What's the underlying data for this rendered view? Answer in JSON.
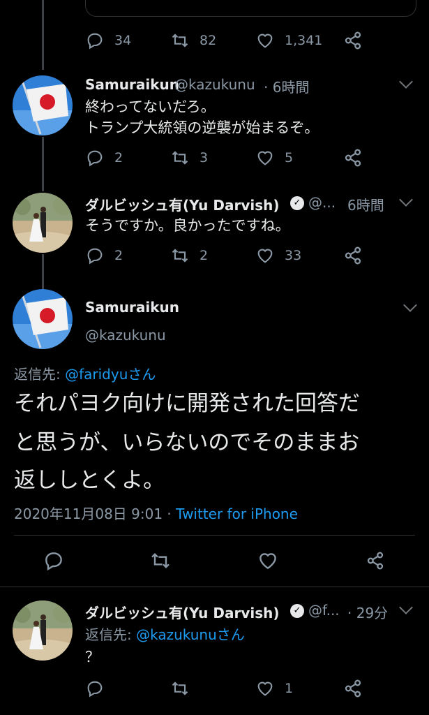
{
  "top_tweet": {
    "reply_count": "34",
    "retweet_count": "82",
    "like_count": "1,341"
  },
  "tweet1": {
    "name": "Samuraikun",
    "handle": "@kazukunu",
    "time": "· 6時間",
    "line1": "終わってないだろ。",
    "line2": "トランプ大統領の逆襲が始まるぞ。",
    "reply_count": "2",
    "retweet_count": "3",
    "like_count": "5"
  },
  "tweet2": {
    "name": "ダルビッシュ有(Yu Darvish)",
    "verified_mark": "✓",
    "handle": "@...",
    "time": "6時間",
    "line1": "そうですか。良かったですね。",
    "reply_count": "2",
    "retweet_count": "2",
    "like_count": "33"
  },
  "focused_tweet": {
    "name": "Samuraikun",
    "handle": "@kazukunu",
    "reply_prefix": "返信先: ",
    "reply_to": "@faridyuさん",
    "line1": "それパヨク向けに開発された回答だ",
    "line2": "と思うが、いらないのでそのままお",
    "line3": "返ししとくよ。",
    "datetime": "2020年11月08日 9:01",
    "separator": " · ",
    "source": "Twitter for iPhone"
  },
  "tweet3": {
    "name": "ダルビッシュ有(Yu Darvish)",
    "verified_mark": "✓",
    "handle": "@f...",
    "time": "· 29分",
    "reply_prefix": "返信先: ",
    "reply_to": "@kazukunuさん",
    "line1": "？",
    "like_count": "1"
  },
  "colors": {
    "background": "#000000",
    "link": "#1d9bf0",
    "muted": "#8b98a5",
    "text": "#e7e9ea",
    "divider": "#2f3336"
  },
  "icons": [
    "reply-icon",
    "retweet-icon",
    "like-icon",
    "share-icon",
    "chevron-down-icon",
    "verified-icon"
  ]
}
